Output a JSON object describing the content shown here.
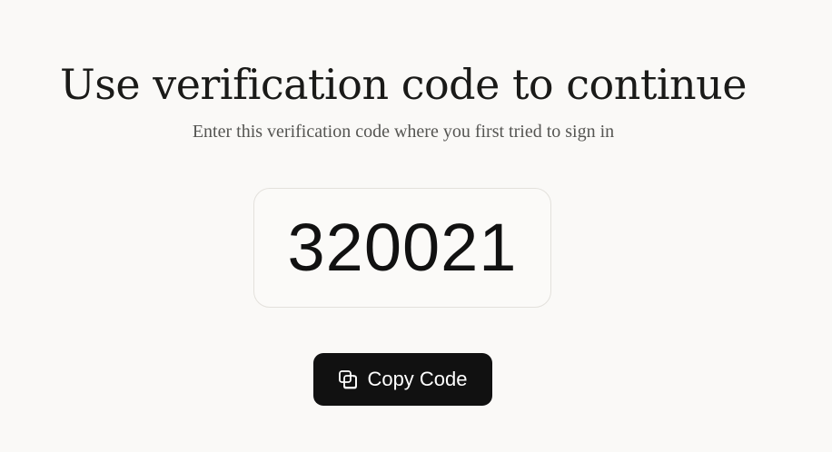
{
  "verification": {
    "title": "Use verification code to continue",
    "subtitle": "Enter this verification code where you first tried to sign in",
    "code": "320021"
  },
  "actions": {
    "copy_label": "Copy Code",
    "copy_icon": "copy-icon"
  },
  "colors": {
    "background": "#faf9f7",
    "button_background": "#111111",
    "button_text": "#ffffff",
    "title_text": "#1a1a18",
    "subtitle_text": "#555552",
    "code_box_border": "#e3e1dc"
  }
}
